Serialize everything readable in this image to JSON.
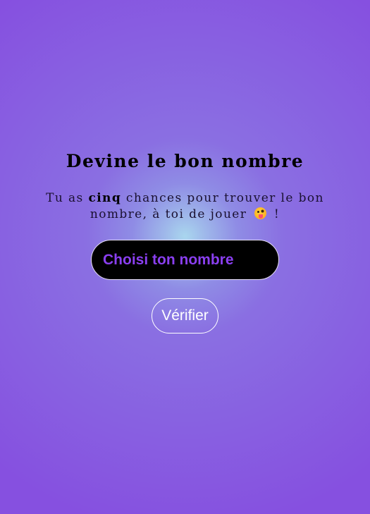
{
  "game": {
    "title": "Devine le bon nombre",
    "intro_prefix": "Tu as ",
    "intro_bold": "cinq",
    "intro_middle": " chances pour trouver le bon nombre, à toi de jouer ",
    "intro_suffix": " !",
    "emoji_icon": "face-with-tongue-emoji"
  },
  "guess_input": {
    "placeholder": "Choisi ton nombre",
    "value": ""
  },
  "verify_button": {
    "label": "Vérifier"
  },
  "colors": {
    "background_outer": "#8650e0",
    "background_glow": "#a9d6ee",
    "input_background": "#000000",
    "input_text": "#8a3ff0",
    "button_border": "#ffffff"
  }
}
